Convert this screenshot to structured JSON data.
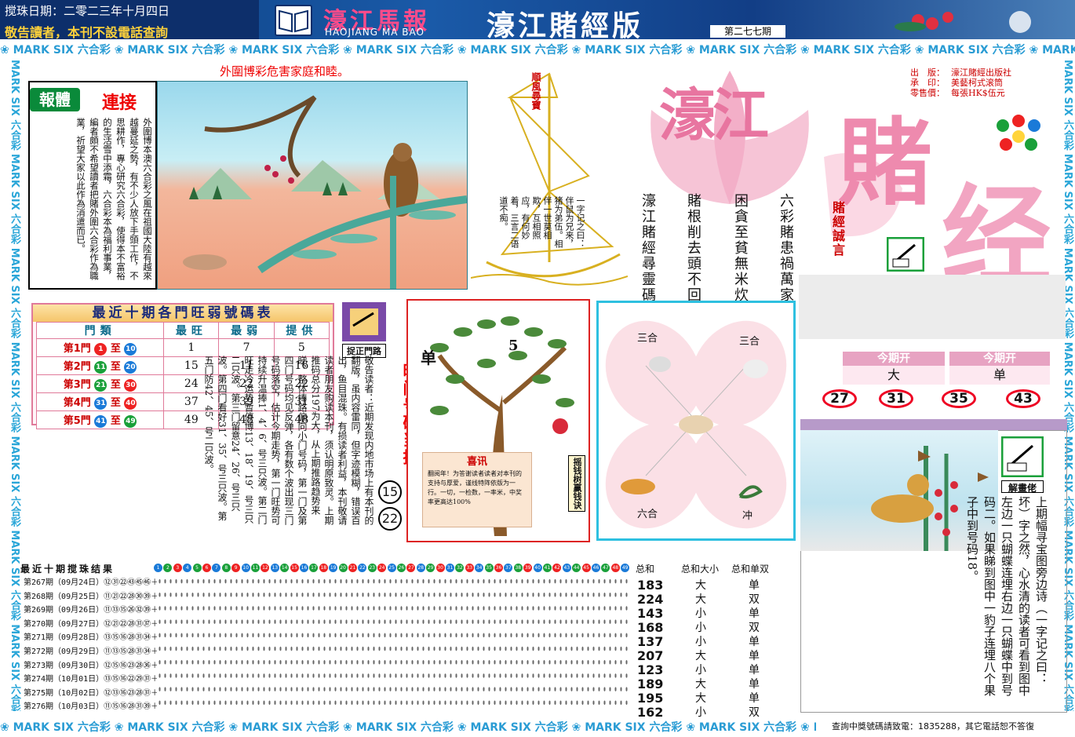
{
  "header": {
    "draw_date": "搅珠日期：二零二三年十月四日",
    "warning": "敬告讀者，本刊不設電話查詢",
    "paper_name": "濠江馬報",
    "paper_name_en": "HAOJIANG MA BAO",
    "edition": "濠江賭經版",
    "issue": "第二七七期"
  },
  "strip": {
    "unit_en": "MARK SIX",
    "unit_cn": "六合彩",
    "vertical": "MARK SIX 六合彩 MARK SIX 六合彩 MARK SIX 六合彩 MARK SIX 六合彩 MARK SIX 六合彩 MARK SIX 六合彩 MARK SIX 六合彩 MARK SIX 六合彩"
  },
  "baoti": {
    "banner": "報體",
    "link": "連接",
    "text": "外圍博本澳六合彩之風在祖國大陸有越來越蔓延之勢，有不少人放下手頭工作，不思耕作，專心研究六合彩，使得本不富裕的生活雪中添霜，六合彩本為福利事業，編者頗不希望讀者把賭外圍六合彩作為職業，祈望大家以此作為消遣而已。"
  },
  "scene1": {
    "title": "外圍博彩危害家庭和睦。"
  },
  "boat": {
    "sail": "順風尋寶",
    "poem": "一字记之曰：伴鼠为兄来，猪为弟伍。相伴一世莫相欺，互相照应，有何妙着，三言二语道不痴。"
  },
  "masthead": {
    "big1": "濠江",
    "big2": "賭",
    "big3": "经",
    "publisher_label": "出　版：",
    "publisher": "濠江賭經出版社",
    "printer_label": "承　印：",
    "printer": "美藝柯式滚筒",
    "price_label": "零售價：",
    "price": "每張HK$伍元",
    "col1": "六彩賭患禍萬家",
    "col2": "困貪至貧無米炊",
    "col3": "賭根削去頭不回",
    "col4": "濠江賭經尋靈碼",
    "motto": "賭經誠言"
  },
  "hotcold": {
    "title": "最近十期各門旺弱號碼表",
    "headers": [
      "門類",
      "最旺",
      "最弱",
      "提供"
    ],
    "rows": [
      {
        "gate": "第1門",
        "from": "1",
        "to": "10",
        "hot": "1",
        "cold": "7",
        "give": "5",
        "c1": "#e22",
        "c2": "#1a7ad8"
      },
      {
        "gate": "第2門",
        "from": "11",
        "to": "20",
        "hot": "15",
        "cold": "11",
        "give": "16",
        "c1": "#1aa03a",
        "c2": "#1a7ad8"
      },
      {
        "gate": "第3門",
        "from": "21",
        "to": "30",
        "hot": "24",
        "cold": "22",
        "give": "22",
        "c1": "#1aa03a",
        "c2": "#e22"
      },
      {
        "gate": "第4門",
        "from": "31",
        "to": "40",
        "hot": "37",
        "cold": "39",
        "give": "31",
        "c1": "#1a7ad8",
        "c2": "#e22"
      },
      {
        "gate": "第5門",
        "from": "41",
        "to": "49",
        "hot": "49",
        "cold": "48",
        "give": "48",
        "c1": "#1a7ad8",
        "c2": "#1aa03a"
      }
    ],
    "to_label": "至"
  },
  "zhuozheng": {
    "label": "捉正門路"
  },
  "article2": "敬告读者：近期发现内地市场上有本刊的翻版，虽内容雷同，但字迹模糊，错误百出，鱼目混珠。有损读者利益，本刊敬请读者朋友购读本刊，须认明原致灵。上期推码总分197为大，从上期推路趋势来睇，整体捧路偏向小门号码，第一门及第四门号码均见反弹，各有数个波出现三门号码落空，估计今期走势，第一门旺势可持续升温捧1、4、6、号三只波。第二门旺走冷运势暂停博13、18、19、号三只二只波。第三门留意24、26、号三只波。第四门看好31、35、号三只波。第五门防42、45、号二只波。",
  "wangmen": {
    "title": "旺门号码当捧",
    "n1": "15",
    "n2": "22"
  },
  "tree": {
    "dan": "单",
    "num": "5",
    "card_title": "喜讯",
    "card_text": "翻阅年！为答谢读者读者对本刊的支持与厚爱，谨线特阵依版为一行。一切，一检数，一率米，中奖率更高达100%",
    "side": "摇钱树赢钱诀"
  },
  "zodiac": {
    "tl": "三合",
    "tr": "三合",
    "bl": "六合",
    "br": "冲"
  },
  "this_issue": {
    "head1": "今期开",
    "head2": "今期开",
    "val1": "大",
    "val2": "单",
    "nums": [
      "27",
      "31",
      "35",
      "43"
    ]
  },
  "puzzle": {
    "label": "解畫佬",
    "text": "上期幅寻宝图旁边诗（一字记之曰：坏）字之然，心水清的读者可看到图中左边一只蝴蝶连埋右边一只蝴蝶中到号码二。如果睇到图中一豹子连埋八个果子中到号码18。"
  },
  "results": {
    "title": "最近十期搅珠结果",
    "rows": [
      "第267期（09月24日）⑫㉛㉒㊸㊺㊻＋⑮",
      "第268期（09月25日）⑪㉑㉒㉘㉚㊴＋⑩",
      "第269期（09月26日）⑪⑬⑮㉖㉜㊴＋⑬",
      "第270期（09月27日）⑫㉑㉒㉘㉛㊲＋⑫",
      "第271期（09月28日）⑬⑮⑯㉘㉛㉞＋⑭",
      "第272期（09月29日）⑪⑬⑮㉘㉛㉞＋⑫",
      "第273期（09月30日）⑫⑮⑯㉓㉘㊱＋⑬",
      "第274期（10月01日）⑬⑮⑯㉒㉙㉛＋⑮",
      "第275期（10月02日）⑫⑬⑯㉓㉘㉛＋⑪",
      "第276期（10月03日）⑪⑮⑯㉘㉛㊴＋⑱"
    ],
    "sum_label": "总和",
    "bigsmall_label": "总和大小",
    "oddeven_label": "总和单双",
    "sums": [
      "183",
      "224",
      "143",
      "168",
      "137",
      "207",
      "123",
      "189",
      "195",
      "162"
    ],
    "bigsmall": [
      "大",
      "大",
      "小",
      "小",
      "小",
      "大",
      "小",
      "大",
      "大",
      "小"
    ],
    "oddeven": [
      "单",
      "双",
      "单",
      "双",
      "单",
      "单",
      "单",
      "单",
      "单",
      "双"
    ]
  },
  "footer": "查詢中獎號碼請致電：1835288，其它電話恕不答復"
}
